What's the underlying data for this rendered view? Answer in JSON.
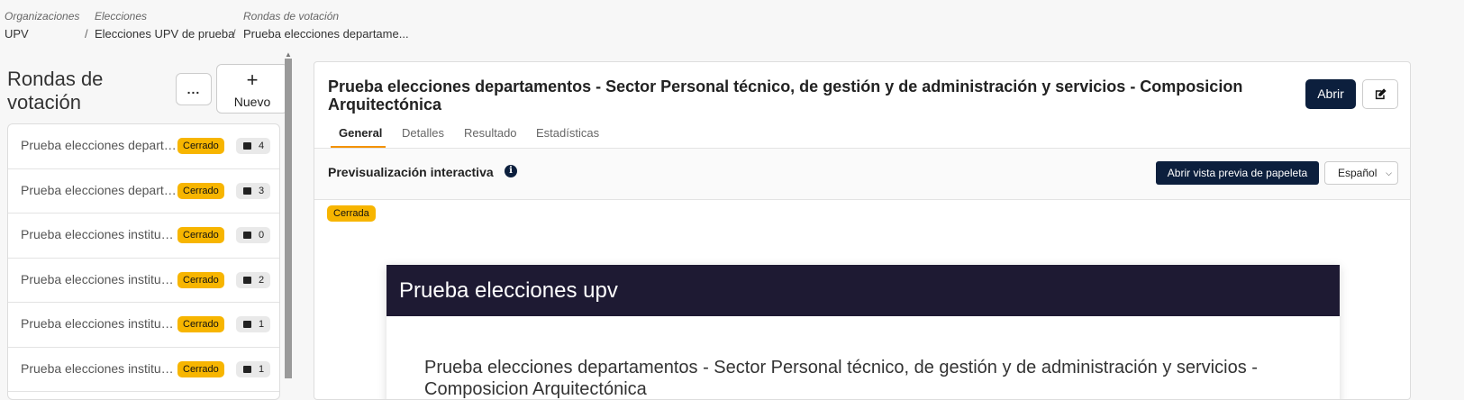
{
  "breadcrumb": [
    {
      "caption": "Organizaciones",
      "value": "UPV"
    },
    {
      "caption": "Elecciones",
      "value": "Elecciones UPV de prueba"
    },
    {
      "caption": "Rondas de votación",
      "value": "Prueba elecciones departame..."
    }
  ],
  "breadcrumb_separator": "/",
  "sidebar": {
    "title": "Rondas de votación",
    "more_label": "...",
    "new_icon": "+",
    "new_label": "Nuevo",
    "items": [
      {
        "name": "Prueba elecciones departamentos",
        "status": "Cerrado",
        "count": "4"
      },
      {
        "name": "Prueba elecciones departamentos",
        "status": "Cerrado",
        "count": "3"
      },
      {
        "name": "Prueba elecciones institucionales",
        "status": "Cerrado",
        "count": "0"
      },
      {
        "name": "Prueba elecciones institucionales",
        "status": "Cerrado",
        "count": "2"
      },
      {
        "name": "Prueba elecciones institucionales",
        "status": "Cerrado",
        "count": "1"
      },
      {
        "name": "Prueba elecciones institucionales",
        "status": "Cerrado",
        "count": "1"
      }
    ]
  },
  "main": {
    "title": "Prueba elecciones departamentos - Sector Personal técnico, de gestión y de administración y servicios - Composicion Arquitectónica",
    "open_label": "Abrir",
    "edit_icon": "edit-icon",
    "tabs": [
      {
        "label": "General",
        "active": true
      },
      {
        "label": "Detalles",
        "active": false
      },
      {
        "label": "Resultado",
        "active": false
      },
      {
        "label": "Estadísticas",
        "active": false
      }
    ],
    "preview": {
      "title": "Previsualización interactiva",
      "info_icon": "i",
      "open_preview_label": "Abrir vista previa de papeleta",
      "language": "Español",
      "status": "Cerrada"
    },
    "ballot": {
      "header": "Prueba elecciones upv",
      "question": "Prueba elecciones departamentos - Sector Personal técnico, de gestión y de administración y servicios - Composicion Arquitectónica"
    }
  },
  "colors": {
    "accent": "#f39200",
    "primary_dark": "#0c1f3d",
    "badge_yellow": "#f7b500",
    "ballot_header": "#1e1a33"
  }
}
